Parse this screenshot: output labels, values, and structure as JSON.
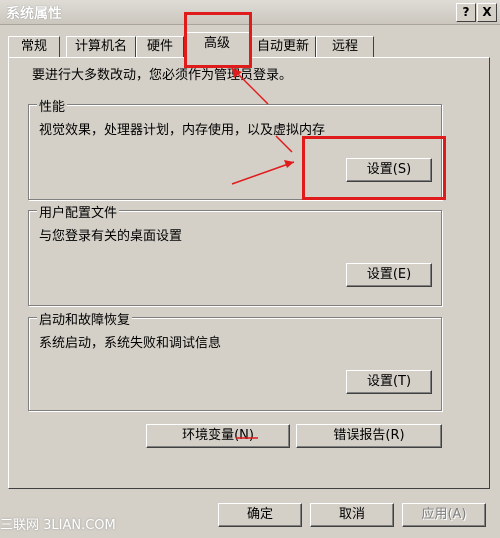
{
  "window": {
    "title": "系统属性",
    "help_label": "?",
    "close_label": "X"
  },
  "tabs": [
    {
      "label": "常规"
    },
    {
      "label": "计算机名"
    },
    {
      "label": "硬件"
    },
    {
      "label": "高级"
    },
    {
      "label": "自动更新"
    },
    {
      "label": "远程"
    }
  ],
  "notice": "要进行大多数改动，您必须作为管理员登录。",
  "groups": {
    "performance": {
      "title": "性能",
      "desc": "视觉效果，处理器计划，内存使用，以及虚拟内存",
      "button": "设置(S)"
    },
    "profile": {
      "title": "用户配置文件",
      "desc": "与您登录有关的桌面设置",
      "button": "设置(E)"
    },
    "startup": {
      "title": "启动和故障恢复",
      "desc": "系统启动，系统失败和调试信息",
      "button": "设置(T)"
    }
  },
  "bottom_buttons": {
    "env": "环境变量(N)",
    "error": "错误报告(R)"
  },
  "dialog_buttons": {
    "ok": "确定",
    "cancel": "取消",
    "apply": "应用(A)"
  },
  "watermark": "三联网 3LIAN.COM",
  "colors": {
    "highlight": "#e01b1b",
    "face": "#d4d0c8"
  }
}
